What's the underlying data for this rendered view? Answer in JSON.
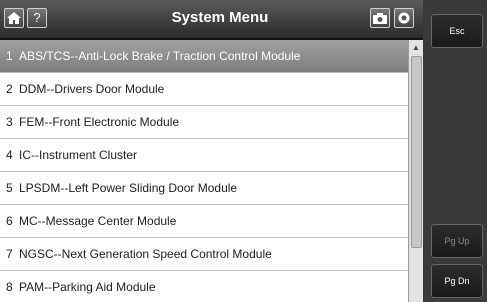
{
  "header": {
    "title": "System Menu",
    "home_icon": "home-icon",
    "help_label": "?",
    "camera_icon": "camera-icon",
    "record_icon": "record-icon"
  },
  "menu": {
    "items": [
      {
        "num": "1",
        "label": "ABS/TCS--Anti-Lock Brake / Traction Control Module",
        "selected": true
      },
      {
        "num": "2",
        "label": "DDM--Drivers Door Module"
      },
      {
        "num": "3",
        "label": "FEM--Front Electronic Module"
      },
      {
        "num": "4",
        "label": "IC--Instrument Cluster"
      },
      {
        "num": "5",
        "label": "LPSDM--Left Power Sliding Door Module"
      },
      {
        "num": "6",
        "label": "MC--Message Center Module"
      },
      {
        "num": "7",
        "label": "NGSC--Next Generation Speed Control Module"
      },
      {
        "num": "8",
        "label": "PAM--Parking Aid Module"
      }
    ]
  },
  "side": {
    "esc_label": "Esc",
    "pgup_label": "Pg Up",
    "pgdn_label": "Pg Dn"
  }
}
